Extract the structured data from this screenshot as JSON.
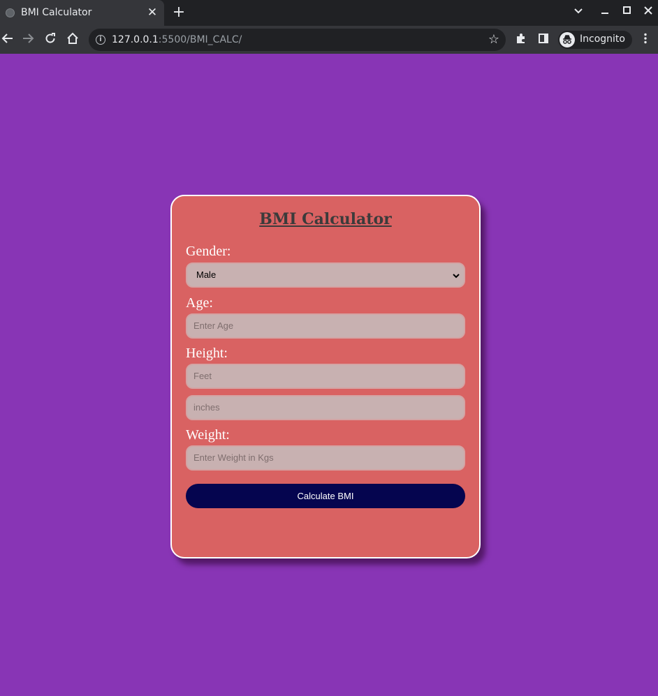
{
  "browser": {
    "tab_title": "BMI Calculator",
    "tab_close": "✕",
    "new_tab": "+",
    "url_host": "127.0.0.1",
    "url_rest": ":5500/BMI_CALC/",
    "incognito_label": "Incognito"
  },
  "form": {
    "title": "BMI Calculator",
    "gender_label": "Gender:",
    "gender_value": "Male",
    "age_label": "Age:",
    "age_placeholder": "Enter Age",
    "height_label": "Height:",
    "feet_placeholder": "Feet",
    "inches_placeholder": "inches",
    "weight_label": "Weight:",
    "weight_placeholder": "Enter Weight in Kgs",
    "submit_label": "Calculate BMI"
  },
  "colors": {
    "page_background": "#8835b5",
    "card_background": "#d96262",
    "button_background": "#05054f",
    "input_background": "#c8b1b1"
  }
}
